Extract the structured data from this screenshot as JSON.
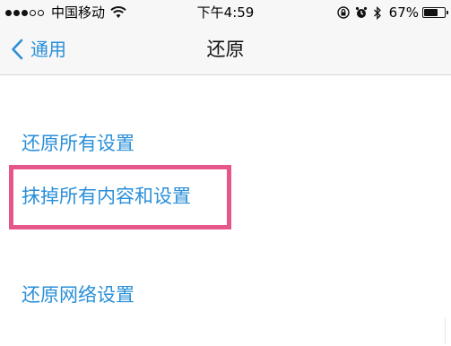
{
  "status_bar": {
    "carrier": "中国移动",
    "time": "下午4:59",
    "battery": "67%",
    "battery_level": 0.67
  },
  "nav": {
    "back_label": "通用",
    "title": "还原"
  },
  "options": [
    {
      "label": "还原所有设置"
    },
    {
      "label": "抹掉所有内容和设置",
      "highlighted": true
    },
    {
      "label": "还原网络设置"
    }
  ],
  "colors": {
    "accent": "#2a8fd8",
    "highlight": "#e7568a"
  },
  "icons": [
    "signal-dots-icon",
    "wifi-icon",
    "rotation-lock-icon",
    "alarm-icon",
    "bluetooth-icon",
    "battery-icon",
    "chevron-left-icon"
  ]
}
